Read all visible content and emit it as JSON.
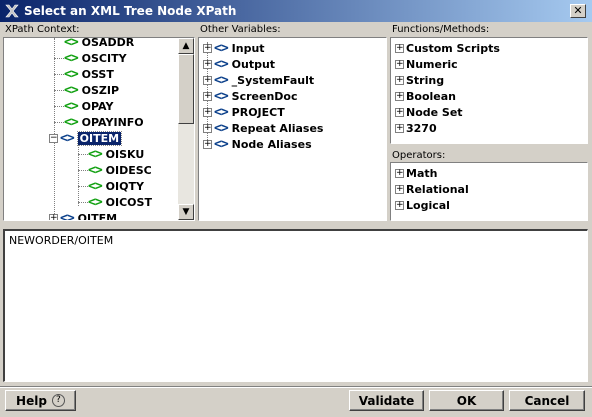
{
  "window": {
    "title": "Select an XML Tree Node XPath",
    "close_glyph": "✕"
  },
  "labels": {
    "xpath_context": "XPath Context:",
    "other_variables": "Other Variables:",
    "functions_methods": "Functions/Methods:",
    "operators": "Operators:"
  },
  "context_tree": {
    "nodes": [
      {
        "label": "OSADDR"
      },
      {
        "label": "OSCITY"
      },
      {
        "label": "OSST"
      },
      {
        "label": "OSZIP"
      },
      {
        "label": "OPAY"
      },
      {
        "label": "OPAYINFO"
      },
      {
        "label": "OITEM",
        "selected": true
      },
      {
        "label": "OISKU"
      },
      {
        "label": "OIDESC"
      },
      {
        "label": "OIQTY"
      },
      {
        "label": "OICOST"
      },
      {
        "label": "OITEM"
      }
    ]
  },
  "other_variables": {
    "items": [
      {
        "label": "Input"
      },
      {
        "label": "Output"
      },
      {
        "label": "_SystemFault"
      },
      {
        "label": "ScreenDoc"
      },
      {
        "label": "PROJECT"
      },
      {
        "label": "Repeat Aliases"
      },
      {
        "label": "Node Aliases"
      }
    ]
  },
  "functions": {
    "items": [
      {
        "label": "Custom Scripts"
      },
      {
        "label": "Numeric"
      },
      {
        "label": "String"
      },
      {
        "label": "Boolean"
      },
      {
        "label": "Node Set"
      },
      {
        "label": "3270"
      }
    ]
  },
  "operators": {
    "items": [
      {
        "label": "Math"
      },
      {
        "label": "Relational"
      },
      {
        "label": "Logical"
      }
    ]
  },
  "xpath_expression": "NEWORDER/OITEM",
  "buttons": {
    "help": "Help",
    "help_glyph": "?",
    "validate": "Validate",
    "ok": "OK",
    "cancel": "Cancel"
  },
  "glyphs": {
    "expand": "+",
    "collapse": "−",
    "tag": "<>",
    "scroll_up": "▲",
    "scroll_down": "▼"
  },
  "colors": {
    "tag_green": "#10a010",
    "tag_blue": "#0a3f8a",
    "selection": "#0a246a"
  }
}
